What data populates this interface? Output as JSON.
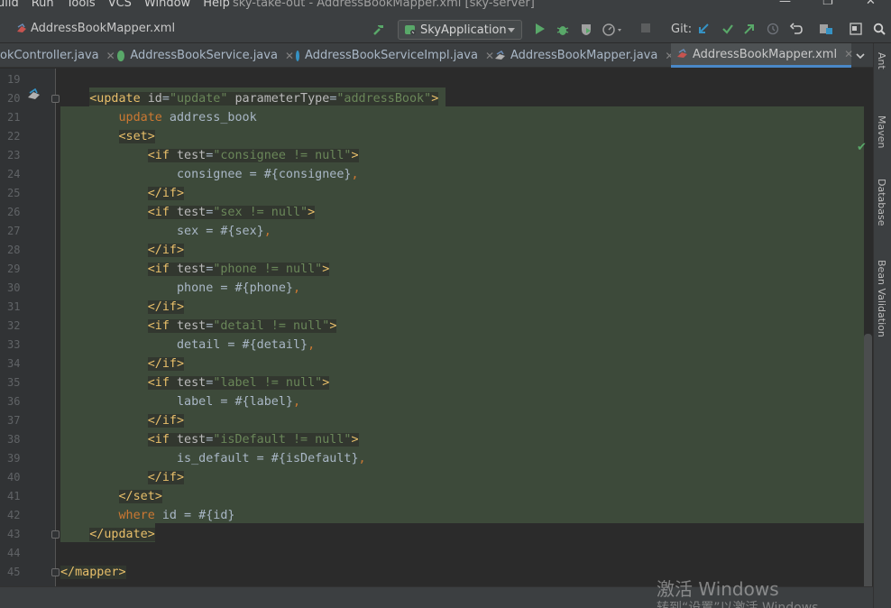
{
  "menu": {
    "items": [
      "uild",
      "Run",
      "Tools",
      "VCS",
      "Window",
      "Help"
    ],
    "window_title": "sky-take-out - AddressBookMapper.xml [sky-server]"
  },
  "navbar": {
    "breadcrumb": "AddressBookMapper.xml",
    "run_config": "SkyApplication",
    "git_label": "Git:"
  },
  "tabs": [
    {
      "label": "okController.java",
      "icon": "class-icon",
      "active": false
    },
    {
      "label": "AddressBookService.java",
      "icon": "interface-icon",
      "active": false
    },
    {
      "label": "AddressBookServiceImpl.java",
      "icon": "class-icon",
      "active": false
    },
    {
      "label": "AddressBookMapper.java",
      "icon": "mybatis-icon",
      "active": false
    },
    {
      "label": "AddressBookMapper.xml",
      "icon": "mybatis-xml-icon",
      "active": true
    }
  ],
  "right_tools": [
    "Ant",
    "Maven",
    "Database",
    "Bean Validation"
  ],
  "editor": {
    "line_numbers": [
      "19",
      "20",
      "21",
      "22",
      "23",
      "24",
      "25",
      "26",
      "27",
      "28",
      "29",
      "30",
      "31",
      "32",
      "33",
      "34",
      "35",
      "36",
      "37",
      "38",
      "39",
      "40",
      "41",
      "42",
      "43",
      "44",
      "45"
    ],
    "lines": [
      "",
      "    <update id=\"update\" parameterType=\"addressBook\">",
      "        update address_book",
      "        <set>",
      "            <if test=\"consignee != null\">",
      "                consignee = #{consignee},",
      "            </if>",
      "            <if test=\"sex != null\">",
      "                sex = #{sex},",
      "            </if>",
      "            <if test=\"phone != null\">",
      "                phone = #{phone},",
      "            </if>",
      "            <if test=\"detail != null\">",
      "                detail = #{detail},",
      "            </if>",
      "            <if test=\"label != null\">",
      "                label = #{label},",
      "            </if>",
      "            <if test=\"isDefault != null\">",
      "                is_default = #{isDefault},",
      "            </if>",
      "        </set>",
      "        where id = #{id}",
      "    </update>",
      "",
      "</mapper>"
    ]
  },
  "watermark": {
    "line1": "激活 Windows",
    "line2": "转到“设置”以激活 Windows"
  },
  "colors": {
    "tag": "#e8bf6a",
    "attr": "#bababa",
    "string": "#6a8759",
    "keyword": "#cc7832",
    "text": "#a9b7c6",
    "selection": "#3d4a3a"
  }
}
